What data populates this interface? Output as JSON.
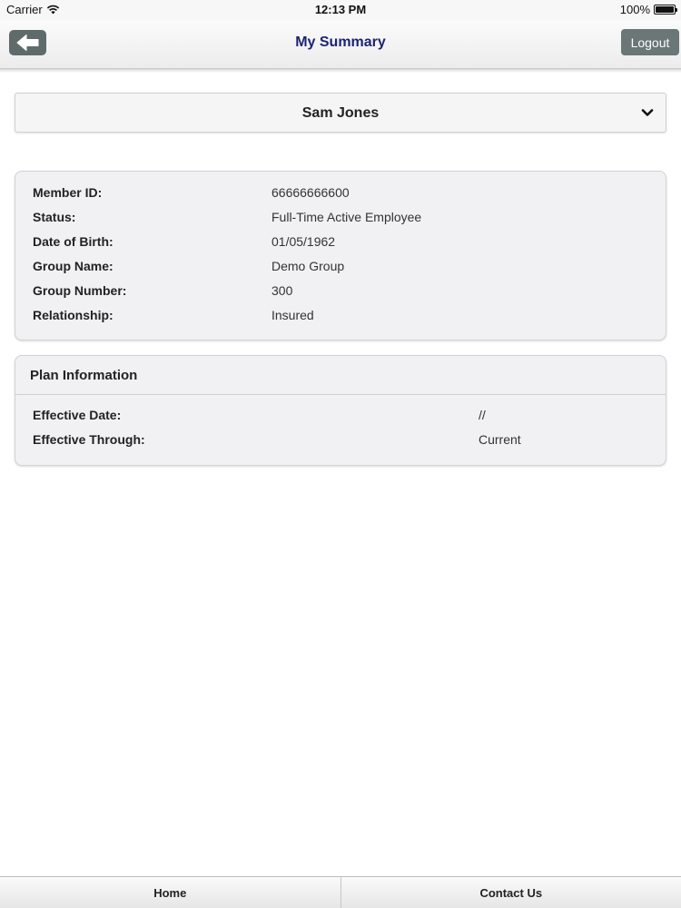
{
  "status_bar": {
    "carrier": "Carrier",
    "time": "12:13 PM",
    "battery": "100%",
    "battery_level": 1.0
  },
  "header": {
    "title": "My Summary",
    "logout_label": "Logout",
    "back_icon": "back-arrow-icon"
  },
  "member_select": {
    "selected": "Sam Jones",
    "icon": "chevron-down-icon"
  },
  "member_info": {
    "rows": [
      {
        "label": "Member ID:",
        "value": "66666666600"
      },
      {
        "label": "Status:",
        "value": "Full-Time Active Employee"
      },
      {
        "label": "Date of Birth:",
        "value": "01/05/1962"
      },
      {
        "label": "Group Name:",
        "value": "Demo Group"
      },
      {
        "label": "Group Number:",
        "value": "300"
      },
      {
        "label": "Relationship:",
        "value": "Insured"
      }
    ]
  },
  "plan_info": {
    "title": "Plan Information",
    "rows": [
      {
        "label": "Effective Date:",
        "value": "//"
      },
      {
        "label": "Effective Through:",
        "value": "Current"
      }
    ]
  },
  "footer": {
    "tabs": [
      {
        "label": "Home"
      },
      {
        "label": "Contact Us"
      }
    ]
  },
  "colors": {
    "title_text": "#1c2470",
    "button_bg": "#5f6b6b",
    "card_bg": "#f1f0f3"
  }
}
